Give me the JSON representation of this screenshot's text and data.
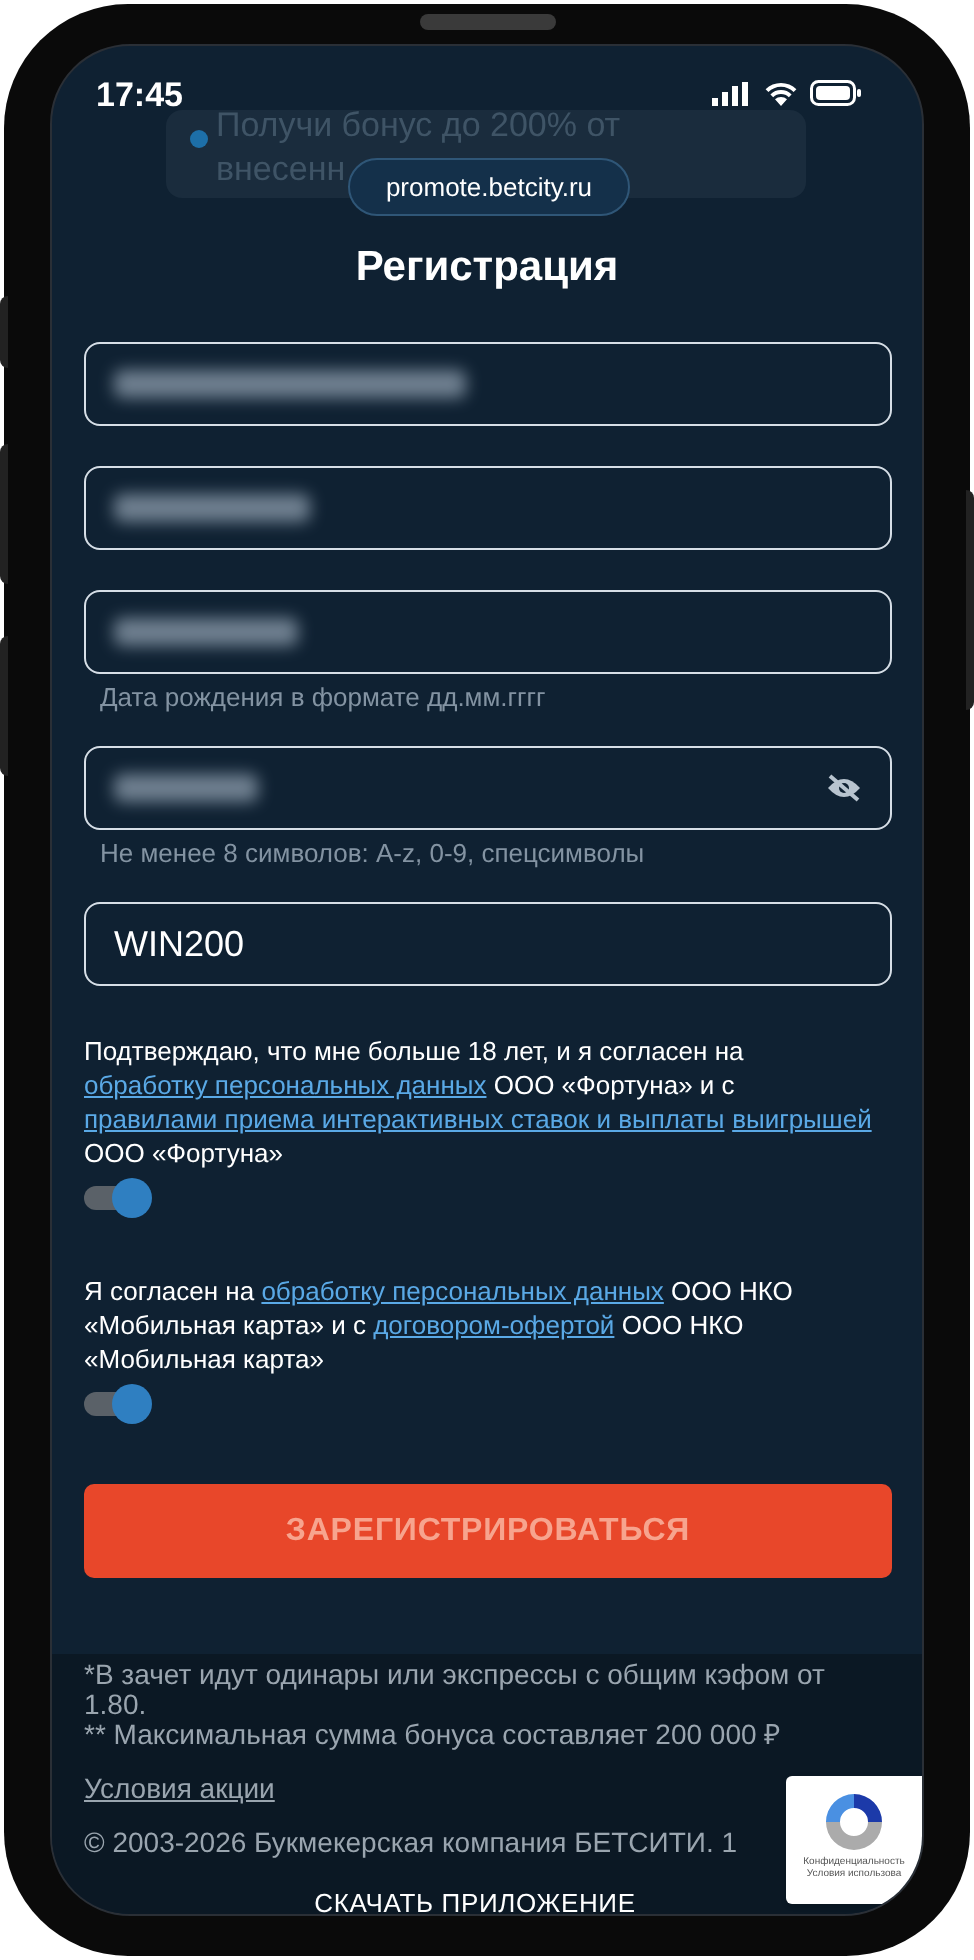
{
  "status_bar": {
    "time": "17:45"
  },
  "banner": {
    "lines": [
      "Получи бонус до 200% от",
      "внесенн"
    ]
  },
  "address_bar": {
    "url": "promote.betcity.ru"
  },
  "title": "Регистрация",
  "fields": [
    {
      "kind": "redacted"
    },
    {
      "kind": "redacted"
    },
    {
      "kind": "redacted",
      "hint": "Дата рождения в формате дд.мм.гггг"
    },
    {
      "kind": "redacted",
      "password_toggle": true,
      "hint": "Не менее 8 символов: A-z, 0-9, спецсимволы"
    },
    {
      "kind": "text",
      "value": "WIN200"
    }
  ],
  "consents": [
    {
      "parts": [
        {
          "kind": "text",
          "text": "Подтверждаю, что мне больше 18 лет, и я согласен на "
        },
        {
          "kind": "link",
          "text": "обработку персональных данных"
        },
        {
          "kind": "text",
          "text": " ООО «Фортуна» и с "
        },
        {
          "kind": "link",
          "text": "правилами приема интерактивных ставок и выплаты"
        },
        {
          "kind": "link",
          "text": "выигрышей"
        },
        {
          "kind": "text",
          "text": " ООО «Фортуна»"
        }
      ],
      "on": true
    },
    {
      "parts": [
        {
          "kind": "text",
          "text": "Я согласен на "
        },
        {
          "kind": "link",
          "text": "обработку персональных данных"
        },
        {
          "kind": "text",
          "text": " ООО НКО «Мобильная карта» и с "
        },
        {
          "kind": "link",
          "text": "договором-офертой"
        },
        {
          "kind": "text",
          "text": " ООО НКО «Мобильная карта»"
        }
      ],
      "on": true
    }
  ],
  "submit_button": "ЗАРЕГИСТРИРОВАТЬСЯ",
  "footer": {
    "notes": [
      "*В зачет идут одинары или экспрессы с общим кэфом от 1.80.",
      "** Максимальная сумма бонуса составляет 200 000 ₽"
    ],
    "terms_link": "Условия акции",
    "copyright": "© 2003-2026 Букмекерская компания БЕТСИТИ. 1",
    "download_link": "СКАЧАТЬ ПРИЛОЖЕНИЕ"
  },
  "recaptcha": {
    "lines": [
      "Конфиденциальность",
      "Условия использова"
    ]
  }
}
